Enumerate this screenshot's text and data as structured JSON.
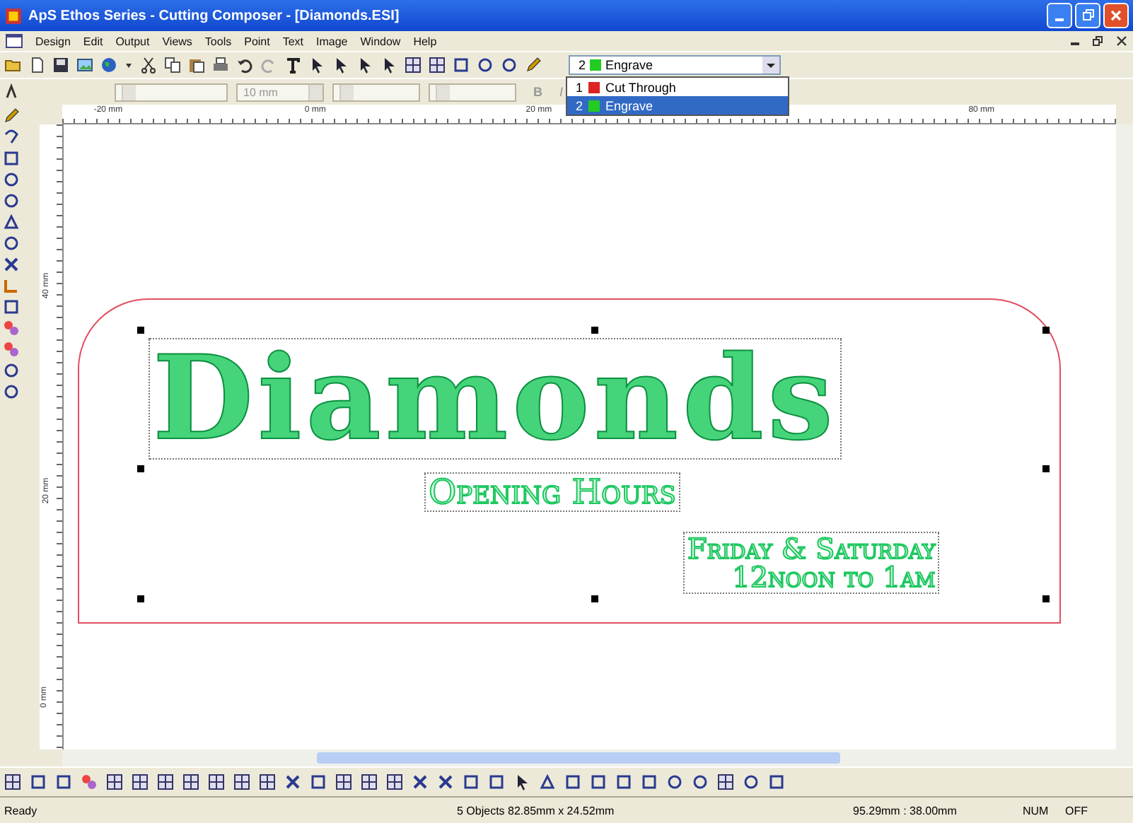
{
  "window": {
    "title": "ApS Ethos Series - Cutting Composer - [Diamonds.ESI]"
  },
  "menu": [
    "Design",
    "Edit",
    "Output",
    "Views",
    "Tools",
    "Point",
    "Text",
    "Image",
    "Window",
    "Help"
  ],
  "format_bar": {
    "font_size": "10 mm",
    "style_buttons": [
      "B",
      "I"
    ]
  },
  "layer_select": {
    "number": "2",
    "value": "Engrave",
    "color": "#22cc22",
    "expanded": true,
    "options": [
      {
        "number": "1",
        "label": "Cut Through",
        "color": "#dd2222",
        "selected": false
      },
      {
        "number": "2",
        "label": "Engrave",
        "color": "#22cc22",
        "selected": true
      }
    ]
  },
  "rulers": {
    "horizontal": [
      "-20 mm",
      "0 mm",
      "20 mm",
      "80 mm"
    ],
    "vertical": [
      "40 mm",
      "20 mm",
      "0 mm"
    ]
  },
  "canvas": {
    "objects": [
      {
        "kind": "title",
        "lines": [
          "Diamonds"
        ]
      },
      {
        "kind": "subtitle",
        "lines": [
          "Opening Hours"
        ]
      },
      {
        "kind": "block",
        "lines": [
          "Friday & Saturday",
          "12noon to 1am"
        ]
      }
    ]
  },
  "status_bar": [
    "Ready",
    "5 Objects 82.85mm x 24.52mm",
    "95.29mm : 38.00mm",
    "NUM",
    "OFF"
  ]
}
